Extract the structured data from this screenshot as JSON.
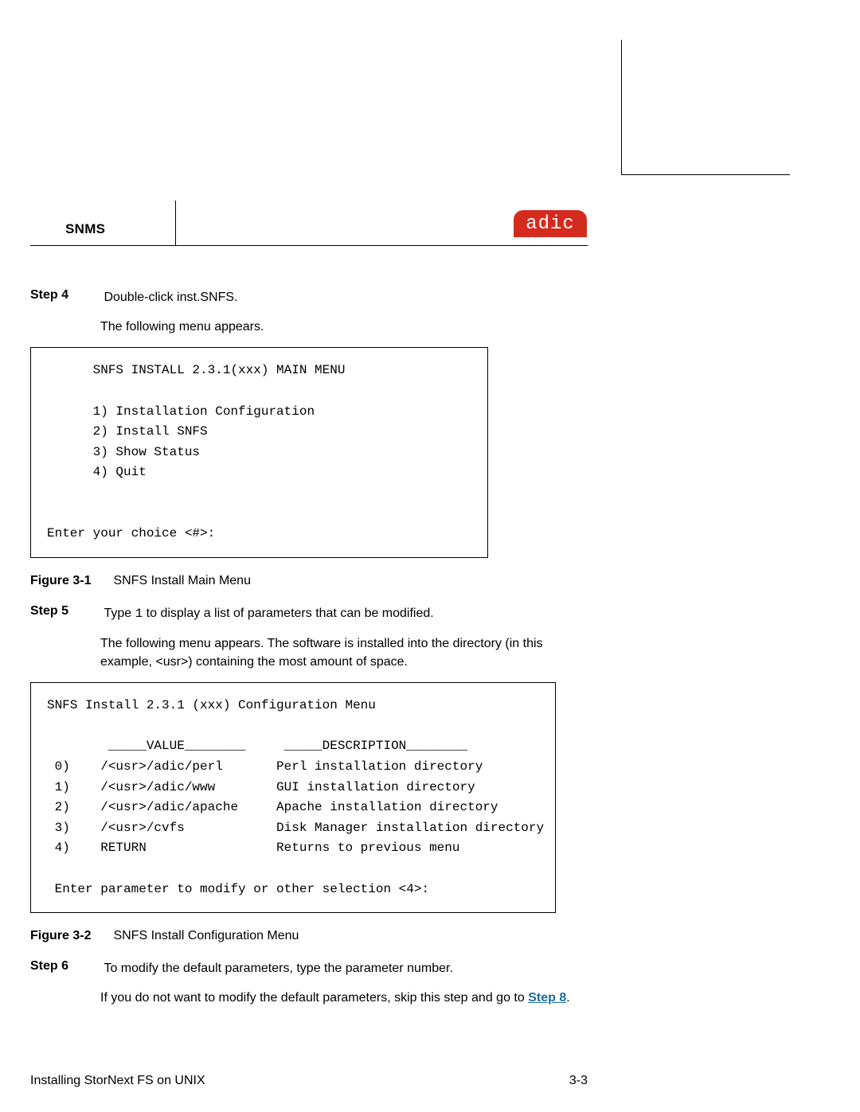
{
  "header": {
    "product": "SNMS",
    "logo": "adic"
  },
  "steps": {
    "step4": {
      "label": "Step 4",
      "text": "Double-click inst.SNFS.",
      "follow": "The following menu appears."
    },
    "step5": {
      "label": "Step 5",
      "text_prefix": "Type ",
      "text_code": "1",
      "text_suffix": " to display a list of parameters that can be modified.",
      "follow": "The following menu appears. The software is installed into the directory (in this example, <usr>) containing the most amount of space."
    },
    "step6": {
      "label": "Step 6",
      "text": "To modify the default parameters, type the parameter number.",
      "follow_prefix": "If you do not want to modify the default parameters, skip this step and go to ",
      "follow_link": "Step 8",
      "follow_suffix": "."
    }
  },
  "codebox1_raw": "      SNFS INSTALL 2.3.1(xxx) MAIN MENU\n\n      1) Installation Configuration\n      2) Install SNFS\n      3) Show Status\n      4) Quit\n\n\nEnter your choice <#>:",
  "figure1": {
    "label": "Figure 3-1",
    "caption": "SNFS Install Main Menu"
  },
  "codebox2_raw": "SNFS Install 2.3.1 (xxx) Configuration Menu\n\n        _____VALUE________     _____DESCRIPTION________\n 0)    /<usr>/adic/perl       Perl installation directory\n 1)    /<usr>/adic/www        GUI installation directory\n 2)    /<usr>/adic/apache     Apache installation directory\n 3)    /<usr>/cvfs            Disk Manager installation directory\n 4)    RETURN                 Returns to previous menu\n\n Enter parameter to modify or other selection <4>:",
  "figure2": {
    "label": "Figure 3-2",
    "caption": "SNFS Install Configuration Menu"
  },
  "footer": {
    "left": "Installing StorNext FS on UNIX",
    "right": "3-3"
  }
}
